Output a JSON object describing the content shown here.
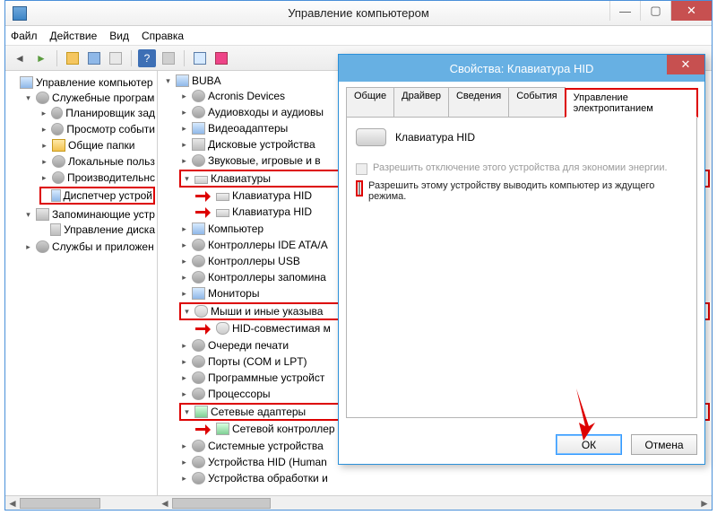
{
  "main": {
    "title": "Управление компьютером",
    "menu": [
      "Файл",
      "Действие",
      "Вид",
      "Справка"
    ]
  },
  "leftTree": {
    "root": "Управление компьютер",
    "g1": "Служебные програм",
    "g1_items": [
      "Планировщик зад",
      "Просмотр событи",
      "Общие папки",
      "Локальные польз",
      "Производительнс"
    ],
    "g1_hl": "Диспетчер устрой",
    "g2": "Запоминающие устр",
    "g2_items": [
      "Управление диска"
    ],
    "g3": "Службы и приложен"
  },
  "rightTree": {
    "root": "BUBA",
    "cat": {
      "acronis": "Acronis Devices",
      "audio": "Аудиовходы и аудиовы",
      "video": "Видеоадаптеры",
      "disk": "Дисковые устройства",
      "sound": "Звуковые, игровые и в",
      "kb": "Клавиатуры",
      "kb_hid": "Клавиатура HID",
      "comp": "Компьютер",
      "ide": "Контроллеры IDE ATA/А",
      "usb": "Контроллеры USB",
      "mem": "Контроллеры запомина",
      "mon": "Мониторы",
      "mouse": "Мыши и иные указыва",
      "mouse_hid": "HID-совместимая м",
      "print": "Очереди печати",
      "ports": "Порты (COM и LPT)",
      "soft": "Программные устройст",
      "proc": "Процессоры",
      "net": "Сетевые адаптеры",
      "net_ctrl": "Сетевой контроллер",
      "sys": "Системные устройства",
      "hid": "Устройства HID (Human",
      "img": "Устройства обработки и"
    }
  },
  "dialog": {
    "title": "Свойства: Клавиатура HID",
    "tabs": [
      "Общие",
      "Драйвер",
      "Сведения",
      "События",
      "Управление электропитанием"
    ],
    "device": "Клавиатура HID",
    "chk1": "Разрешить отключение этого устройства для экономии энергии.",
    "chk2": "Разрешить этому устройству выводить компьютер из ждущего режима.",
    "ok": "ОК",
    "cancel": "Отмена"
  }
}
